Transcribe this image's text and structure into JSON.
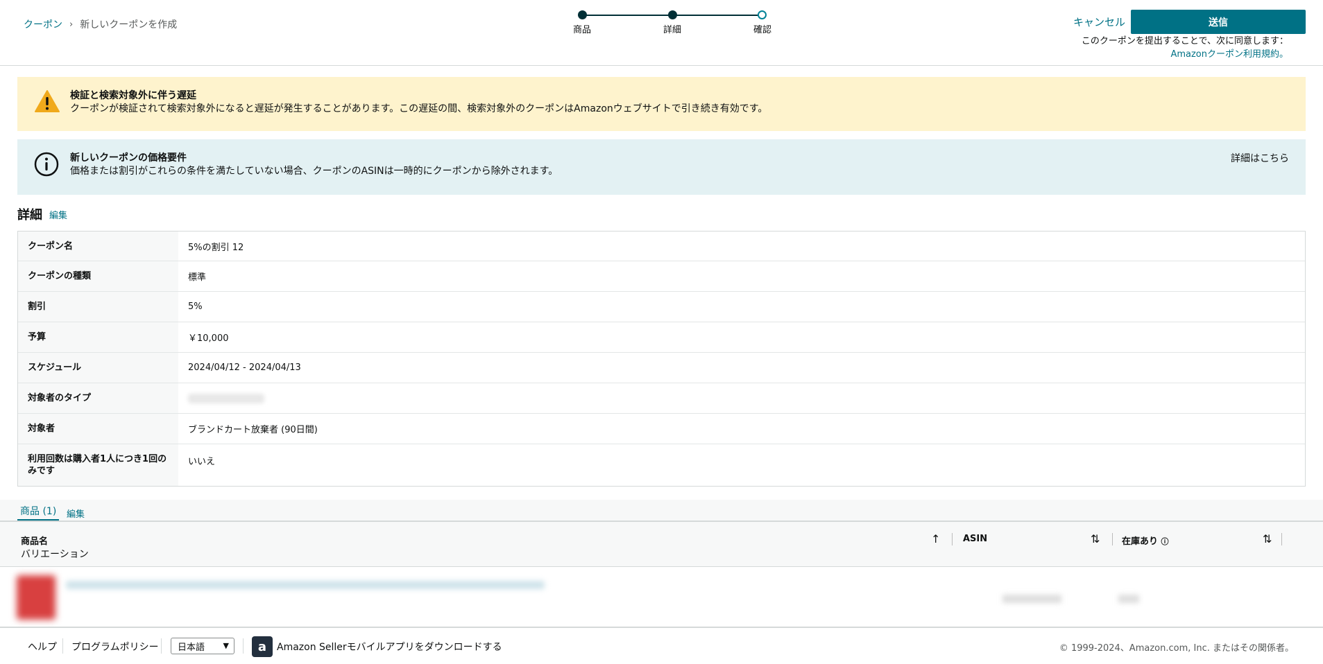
{
  "breadcrumb": {
    "root": "クーポン",
    "separator": "›",
    "current": "新しいクーポンを作成"
  },
  "stepper": {
    "steps": [
      "商品",
      "詳細",
      "確認"
    ]
  },
  "header": {
    "cancel_label": "キャンセル",
    "submit_label": "送信",
    "agree_text": "このクーポンを提出することで、次に同意します：",
    "terms_link": "Amazonクーポン利用規約。"
  },
  "alerts": {
    "warning": {
      "title": "検証と検索対象外に伴う遅延",
      "body": "クーポンが検証されて検索対象外になると遅延が発生することがあります。この遅延の間、検索対象外のクーポンはAmazonウェブサイトで引き続き有効です。"
    },
    "info": {
      "title": "新しいクーポンの価格要件",
      "body": "価格または割引がこれらの条件を満たしていない場合、クーポンのASINは一時的にクーポンから除外されます。",
      "link": "詳細はこちら"
    }
  },
  "details": {
    "title": "詳細",
    "edit_label": "編集",
    "rows": [
      {
        "label": "クーポン名",
        "value": "5%の割引 12"
      },
      {
        "label": "クーポンの種類",
        "value": "標準"
      },
      {
        "label": "割引",
        "value": "5%"
      },
      {
        "label": "予算",
        "value": "￥10,000"
      },
      {
        "label": "スケジュール",
        "value": "2024/04/12 - 2024/04/13"
      },
      {
        "label": "対象者のタイプ",
        "value": ""
      },
      {
        "label": "対象者",
        "value": "ブランドカート放棄者 (90日間)"
      },
      {
        "label": "利用回数は購入者1人につき1回のみです",
        "value": "いいえ"
      }
    ]
  },
  "products": {
    "tab_label": "商品 (1)",
    "edit_label": "編集",
    "columns": {
      "name": "商品名",
      "variation": "バリエーション",
      "asin": "ASIN",
      "stock": "在庫あり"
    }
  },
  "footer": {
    "help": "ヘルプ",
    "policy": "プログラムポリシー",
    "language": "日本語",
    "app_text": "Amazon Sellerモバイルアプリをダウンロードする",
    "copyright": "© 1999-2024、Amazon.com, Inc. またはその関係者。"
  }
}
